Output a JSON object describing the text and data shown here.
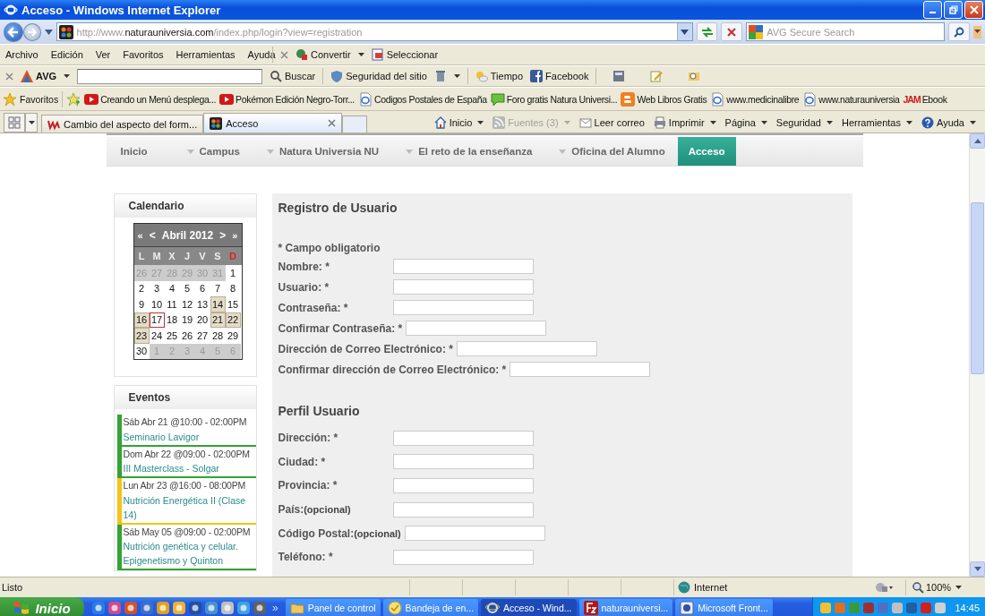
{
  "window": {
    "title": "Acceso - Windows Internet Explorer"
  },
  "address_bar": {
    "url_prefix": "http://www.",
    "url_domain": "naturauniversia.com",
    "url_path": "/index.php/login?view=registration",
    "search_placeholder": "AVG Secure Search"
  },
  "menu": [
    "Archivo",
    "Edición",
    "Ver",
    "Favoritos",
    "Herramientas",
    "Ayuda"
  ],
  "convert_bar": {
    "convert": "Convertir",
    "select": "Seleccionar"
  },
  "avg_toolbar": {
    "brand": "AVG",
    "search_button": "Buscar",
    "site_safety": "Seguridad del sitio",
    "weather": "Tiempo",
    "facebook": "Facebook"
  },
  "favorites_bar": {
    "label": "Favoritos",
    "links": [
      {
        "label": "Creando un Menú desplega...",
        "kind": "video"
      },
      {
        "label": "Pokémon Edición Negro-Torr...",
        "kind": "video"
      },
      {
        "label": "Codigos Postales de España",
        "kind": "page"
      },
      {
        "label": "Foro gratis  Natura Universi...",
        "kind": "forum"
      },
      {
        "label": "Web Libros Gratis",
        "kind": "blog"
      },
      {
        "label": "www.medicinalibre",
        "kind": "page"
      },
      {
        "label": "www.naturauniversia",
        "kind": "page"
      },
      {
        "label": "Ebook",
        "kind": "text_logo",
        "logo_text": "JAM"
      }
    ]
  },
  "tabs": [
    {
      "label": "Cambio del aspecto del form...",
      "selected": false
    },
    {
      "label": "Acceso",
      "selected": true
    }
  ],
  "command_bar": [
    {
      "label": "Inicio",
      "kind": "home",
      "disabled": false,
      "has_menu": true
    },
    {
      "label": "Fuentes (3)",
      "kind": "feed",
      "disabled": true,
      "has_menu": true
    },
    {
      "label": "Leer correo",
      "kind": "mail",
      "disabled": false,
      "has_menu": false
    },
    {
      "label": "Imprimir",
      "kind": "print",
      "disabled": false,
      "has_menu": true
    },
    {
      "label": "Página",
      "kind": "none",
      "disabled": false,
      "has_menu": true
    },
    {
      "label": "Seguridad",
      "kind": "none",
      "disabled": false,
      "has_menu": true
    },
    {
      "label": "Herramientas",
      "kind": "none",
      "disabled": false,
      "has_menu": true
    },
    {
      "label": "Ayuda",
      "kind": "help",
      "disabled": false,
      "has_menu": true
    }
  ],
  "site_nav": [
    {
      "label": "Inicio",
      "has_submenu": false,
      "selected": false
    },
    {
      "label": "Campus",
      "has_submenu": true,
      "selected": false
    },
    {
      "label": "Natura Universia NU",
      "has_submenu": true,
      "selected": false
    },
    {
      "label": "El reto de la enseñanza",
      "has_submenu": true,
      "selected": false
    },
    {
      "label": "Oficina del Alumno",
      "has_submenu": true,
      "selected": false
    },
    {
      "label": "Acceso",
      "has_submenu": false,
      "selected": true
    }
  ],
  "calendar": {
    "title": "Calendario",
    "prev_year": "«",
    "prev_month": "<",
    "month": "Abril 2012",
    "next_month": ">",
    "next_year": "»",
    "weekdays": [
      {
        "label": "L",
        "sunday": false
      },
      {
        "label": "M",
        "sunday": false
      },
      {
        "label": "X",
        "sunday": false
      },
      {
        "label": "J",
        "sunday": false
      },
      {
        "label": "V",
        "sunday": false
      },
      {
        "label": "S",
        "sunday": false
      },
      {
        "label": "D",
        "sunday": true
      }
    ],
    "weeks": [
      [
        {
          "day": "26",
          "kind": "other"
        },
        {
          "day": "27",
          "kind": "other"
        },
        {
          "day": "28",
          "kind": "other"
        },
        {
          "day": "29",
          "kind": "other"
        },
        {
          "day": "30",
          "kind": "other"
        },
        {
          "day": "31",
          "kind": "other"
        },
        {
          "day": "1",
          "kind": "normal"
        }
      ],
      [
        {
          "day": "2",
          "kind": "normal"
        },
        {
          "day": "3",
          "kind": "normal"
        },
        {
          "day": "4",
          "kind": "normal"
        },
        {
          "day": "5",
          "kind": "normal"
        },
        {
          "day": "6",
          "kind": "normal"
        },
        {
          "day": "7",
          "kind": "normal"
        },
        {
          "day": "8",
          "kind": "normal"
        }
      ],
      [
        {
          "day": "9",
          "kind": "normal"
        },
        {
          "day": "10",
          "kind": "normal"
        },
        {
          "day": "11",
          "kind": "normal"
        },
        {
          "day": "12",
          "kind": "normal"
        },
        {
          "day": "13",
          "kind": "normal"
        },
        {
          "day": "14",
          "kind": "event"
        },
        {
          "day": "15",
          "kind": "normal"
        }
      ],
      [
        {
          "day": "16",
          "kind": "event"
        },
        {
          "day": "17",
          "kind": "today"
        },
        {
          "day": "18",
          "kind": "normal"
        },
        {
          "day": "19",
          "kind": "normal"
        },
        {
          "day": "20",
          "kind": "normal"
        },
        {
          "day": "21",
          "kind": "event"
        },
        {
          "day": "22",
          "kind": "event"
        }
      ],
      [
        {
          "day": "23",
          "kind": "event"
        },
        {
          "day": "24",
          "kind": "normal"
        },
        {
          "day": "25",
          "kind": "normal"
        },
        {
          "day": "26",
          "kind": "normal"
        },
        {
          "day": "27",
          "kind": "normal"
        },
        {
          "day": "28",
          "kind": "normal"
        },
        {
          "day": "29",
          "kind": "normal"
        }
      ],
      [
        {
          "day": "30",
          "kind": "normal"
        },
        {
          "day": "1",
          "kind": "other"
        },
        {
          "day": "2",
          "kind": "other"
        },
        {
          "day": "3",
          "kind": "other"
        },
        {
          "day": "4",
          "kind": "other"
        },
        {
          "day": "5",
          "kind": "other"
        },
        {
          "day": "6",
          "kind": "other"
        }
      ]
    ]
  },
  "events": {
    "title": "Eventos",
    "items": [
      {
        "when": "Sáb Abr 21 @10:00 - 02:00PM",
        "title": "Seminario Lavigor",
        "color": "#33a333"
      },
      {
        "when": "Dom Abr 22 @09:00 - 02:00PM",
        "title": "III Masterclass - Solgar",
        "color": "#33a333"
      },
      {
        "when": "Lun Abr 23 @16:00 - 08:00PM",
        "title": "Nutrición Energética II (Clase 14)",
        "color": "#f2c318"
      },
      {
        "when": "Sáb May 05 @09:00 - 02:00PM",
        "title": "Nutrición genética y celular. Epigenetismo y Quinton",
        "color": "#33a333"
      }
    ]
  },
  "registration": {
    "title": "Registro de Usuario",
    "required_note": "* Campo obligatorio",
    "fields": [
      {
        "label": "Nombre: *"
      },
      {
        "label": "Usuario: *"
      },
      {
        "label": "Contraseña: *"
      },
      {
        "label": "Confirmar Contraseña: *"
      },
      {
        "label": "Dirección de Correo Electrónico: *"
      },
      {
        "label": "Confirmar dirección de Correo Electrónico: *"
      }
    ]
  },
  "profile": {
    "title": "Perfil Usuario",
    "fields": [
      {
        "label": "Dirección: *"
      },
      {
        "label": "Ciudad: *"
      },
      {
        "label": "Provincia: *"
      },
      {
        "label": "País:",
        "note": "(opcional)"
      },
      {
        "label": "Código Postal:",
        "note": "(opcional)"
      },
      {
        "label": "Teléfono: *"
      }
    ]
  },
  "status_bar": {
    "text": "Listo",
    "zone": "Internet",
    "zoom": "100%"
  },
  "taskbar": {
    "start": "Inicio",
    "overflow": "»",
    "tasks": [
      {
        "label": "Panel de control",
        "kind": "folder",
        "selected": false
      },
      {
        "label": "Bandeja de en...",
        "kind": "mail",
        "selected": false
      },
      {
        "label": "Acceso - Wind...",
        "kind": "browser",
        "selected": true
      },
      {
        "label": "naturauniversi...",
        "kind": "ftp",
        "selected": false
      },
      {
        "label": "Microsoft Front...",
        "kind": "editor",
        "selected": false
      }
    ],
    "clock": "14:45"
  }
}
